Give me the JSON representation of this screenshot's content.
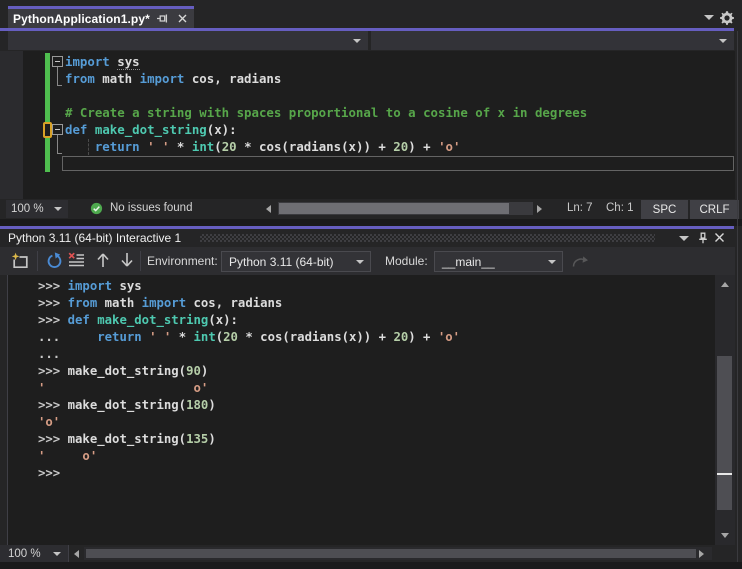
{
  "colors": {
    "accent_purple": "#665EC0",
    "editor_background": "#1E1E1E",
    "chrome_background": "#252526",
    "keyword": "#569CD6",
    "function": "#4EC9B0",
    "comment": "#57A64A",
    "string": "#D69D85",
    "number": "#B5CEA8",
    "change_bar_green": "#4FBE4F",
    "caret_marker_orange": "#D9A227"
  },
  "icons": {
    "tab": [
      "pin-icon",
      "close-icon"
    ],
    "tab_bar": [
      "chevron-down-icon",
      "gear-icon"
    ],
    "editor_status": [
      "check-circle-icon"
    ],
    "interactive_title": [
      "chevron-down-icon",
      "pin-icon",
      "close-icon"
    ],
    "interactive_toolbar": [
      "new-interactive-window-icon",
      "reset-icon",
      "clear-all-icon",
      "history-previous-icon",
      "history-next-icon",
      "redo-icon"
    ]
  },
  "editor": {
    "tab_title": "PythonApplication1.py*",
    "code_lines": [
      [
        [
          "k",
          "import"
        ],
        [
          "t",
          " "
        ],
        [
          "u",
          "sys"
        ]
      ],
      [
        [
          "k",
          "from"
        ],
        [
          "t",
          " math "
        ],
        [
          "k",
          "import"
        ],
        [
          "t",
          " cos, radians"
        ]
      ],
      [],
      [
        [
          "c",
          "# Create a string with spaces proportional to a cosine of x in degrees"
        ]
      ],
      [
        [
          "k",
          "def"
        ],
        [
          "t",
          " "
        ],
        [
          "f",
          "make_dot_string"
        ],
        [
          "t",
          "(x):"
        ]
      ],
      [
        [
          "t",
          "    "
        ],
        [
          "k",
          "return"
        ],
        [
          "t",
          " "
        ],
        [
          "s",
          "' '"
        ],
        [
          "t",
          " * "
        ],
        [
          "f",
          "int"
        ],
        [
          "t",
          "("
        ],
        [
          "n",
          "20"
        ],
        [
          "t",
          " * cos(radians(x)) + "
        ],
        [
          "n",
          "20"
        ],
        [
          "t",
          ") + "
        ],
        [
          "s",
          "'o'"
        ]
      ],
      []
    ],
    "status": {
      "zoom": "100 %",
      "issues": "No issues found",
      "line": "Ln: 7",
      "column": "Ch: 1",
      "spaces": "SPC",
      "line_ending": "CRLF"
    }
  },
  "interactive": {
    "title": "Python 3.11 (64-bit) Interactive 1",
    "toolbar": {
      "environment_label": "Environment:",
      "environment_value": "Python 3.11 (64-bit)",
      "module_label": "Module:",
      "module_value": "__main__"
    },
    "repl_lines": [
      [
        [
          "p",
          ">>> "
        ],
        [
          "k",
          "import"
        ],
        [
          "t",
          " sys"
        ]
      ],
      [
        [
          "p",
          ">>> "
        ],
        [
          "k",
          "from"
        ],
        [
          "t",
          " math "
        ],
        [
          "k",
          "import"
        ],
        [
          "t",
          " cos, radians"
        ]
      ],
      [
        [
          "p",
          ">>> "
        ],
        [
          "k",
          "def"
        ],
        [
          "t",
          " "
        ],
        [
          "f",
          "make_dot_string"
        ],
        [
          "t",
          "(x):"
        ]
      ],
      [
        [
          "p",
          "... "
        ],
        [
          "t",
          "    "
        ],
        [
          "k",
          "return"
        ],
        [
          "t",
          " "
        ],
        [
          "s",
          "' '"
        ],
        [
          "t",
          " * "
        ],
        [
          "f",
          "int"
        ],
        [
          "t",
          "("
        ],
        [
          "n",
          "20"
        ],
        [
          "t",
          " * cos(radians(x)) + "
        ],
        [
          "n",
          "20"
        ],
        [
          "t",
          ") + "
        ],
        [
          "s",
          "'o'"
        ]
      ],
      [
        [
          "p",
          "..."
        ]
      ],
      [
        [
          "p",
          ">>> "
        ],
        [
          "t",
          "make_dot_string("
        ],
        [
          "n",
          "90"
        ],
        [
          "t",
          ")"
        ]
      ],
      [
        [
          "s",
          "'                    o'"
        ]
      ],
      [
        [
          "p",
          ">>> "
        ],
        [
          "t",
          "make_dot_string("
        ],
        [
          "n",
          "180"
        ],
        [
          "t",
          ")"
        ]
      ],
      [
        [
          "s",
          "'o'"
        ]
      ],
      [
        [
          "p",
          ">>> "
        ],
        [
          "t",
          "make_dot_string("
        ],
        [
          "n",
          "135"
        ],
        [
          "t",
          ")"
        ]
      ],
      [
        [
          "s",
          "'     o'"
        ]
      ],
      [
        [
          "p",
          ">>>"
        ]
      ]
    ],
    "status": {
      "zoom": "100 %"
    }
  }
}
